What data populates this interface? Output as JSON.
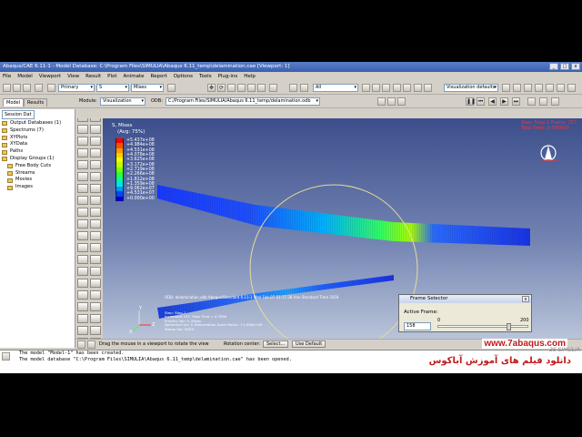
{
  "window": {
    "title": "Abaqus/CAE 6.11-1 - Model Database: C:\\Program Files\\SIMULIA\\Abaqus 6.11_temp\\delamination.cae [Viewport: 1]",
    "controls": [
      "_",
      "□",
      "x"
    ]
  },
  "menu": [
    "File",
    "Model",
    "Viewport",
    "View",
    "Result",
    "Plot",
    "Animate",
    "Report",
    "Options",
    "Tools",
    "Plug-ins",
    "Help"
  ],
  "toolbar": {
    "primary_combo": "Primary",
    "s_combo": "S",
    "mises_combo": "Mises",
    "all_combo": "All",
    "visualization_defaults": "Visualization defaults"
  },
  "context": {
    "module_label": "Module:",
    "module_value": "Visualization",
    "odb_label": "ODB:",
    "odb_value": "C:/Program Files/SIMULIA/Abaqus 6.11_temp/delamination.odb"
  },
  "left_panel": {
    "tabs": [
      "Model",
      "Results"
    ],
    "active_tab": "Results",
    "session_label": "Session Dat",
    "tree": [
      {
        "label": "Output Databases (1)",
        "indent": false
      },
      {
        "label": "Spectrums (7)",
        "indent": false
      },
      {
        "label": "XYPlots",
        "indent": false
      },
      {
        "label": "XYData",
        "indent": false
      },
      {
        "label": "Paths",
        "indent": false
      },
      {
        "label": "Display Groups (1)",
        "indent": false
      },
      {
        "label": "Free Body Cuts",
        "indent": true
      },
      {
        "label": "Streams",
        "indent": true
      },
      {
        "label": "Movies",
        "indent": true
      },
      {
        "label": "Images",
        "indent": true
      }
    ]
  },
  "viewport": {
    "legend_title": "S, Mises",
    "legend_avg": "(Avg: 75%)",
    "legend_values": [
      "+5.437e+08",
      "+4.984e+08",
      "+4.531e+08",
      "+4.078e+08",
      "+3.625e+08",
      "+3.172e+08",
      "+2.719e+08",
      "+2.266e+08",
      "+1.812e+08",
      "+1.359e+08",
      "+9.062e+07",
      "+4.531e+07",
      "+0.000e+00"
    ],
    "legend_colors": [
      "#ff0000",
      "#ff5200",
      "#ff9a00",
      "#ffd000",
      "#f4ff00",
      "#bfff00",
      "#7aff00",
      "#2fff34",
      "#00ff9a",
      "#00e6e6",
      "#0096ff",
      "#0046ff",
      "#0000c8"
    ],
    "step_line1": "Step: Step-1    Frame: 157",
    "step_line2": "Total Time: 0.785000",
    "odb_info": "ODB: delamination.odb    Abaqus/Standard 6.11-1    Wed Feb 07 21:17:38 Iran Standard Time 2018",
    "step_desc": [
      "Step: Step-1",
      "Increment    157: Step Time =    0.7850",
      "Primary Var: S, Mises",
      "Deformed Var: U   Deformation Scale Factor: +1.000e+00",
      "Status Var: SDEG"
    ]
  },
  "frame_selector": {
    "title": "Frame Selector",
    "close": "x",
    "active_frame_label": "Active Frame:",
    "value": "158",
    "min": "0",
    "max": "200",
    "position": 0.79
  },
  "prompt": {
    "text": "Drag the mouse in a viewport to rotate the view",
    "rotation_center_label": "Rotation center:",
    "select_button": "Select...",
    "use_default_button": "Use Default"
  },
  "messages": [
    "The model \"Model-1\" has been created.",
    "The model database \"C:\\Program Files\\SIMULIA\\Abaqus 6.11_temp\\delamination.cae\" has been opened."
  ],
  "watermark": {
    "url": "www.7abaqus.com",
    "persian": "دانلود فیلم های آموزش آباکوس",
    "simulia": "3S SIMULIA"
  }
}
